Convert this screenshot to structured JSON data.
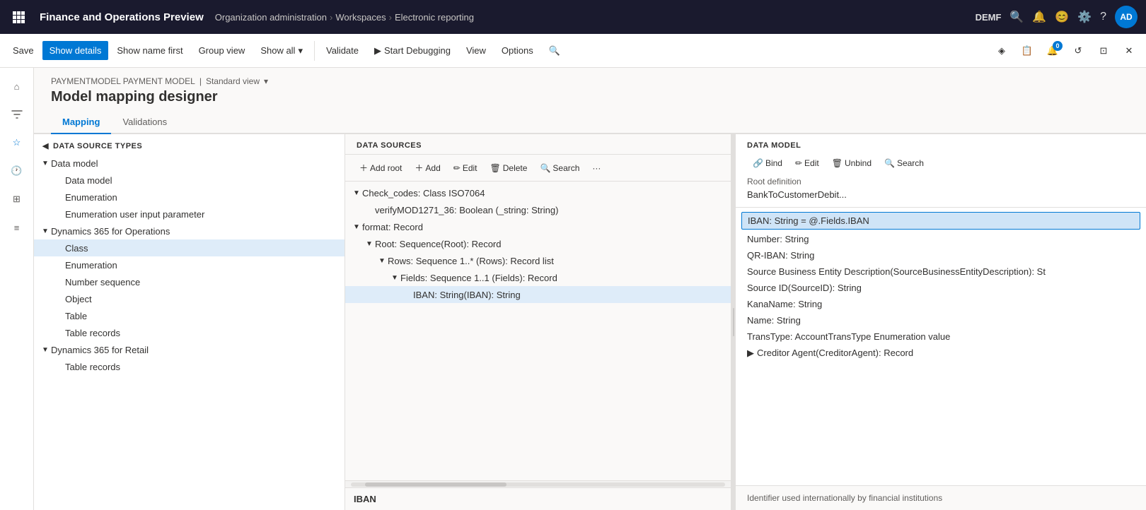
{
  "topNav": {
    "waffle": "⊞",
    "title": "Finance and Operations Preview",
    "breadcrumb": [
      "Organization administration",
      "Workspaces",
      "Electronic reporting"
    ],
    "envLabel": "DEMF",
    "avatar": "AD"
  },
  "toolbar": {
    "save": "Save",
    "showDetails": "Show details",
    "showNameFirst": "Show name first",
    "groupView": "Group view",
    "showAll": "Show all",
    "validate": "Validate",
    "startDebugging": "Start Debugging",
    "view": "View",
    "options": "Options"
  },
  "breadcrumb": {
    "model": "PAYMENTMODEL PAYMENT MODEL",
    "view": "Standard view"
  },
  "pageTitle": "Model mapping designer",
  "tabs": [
    "Mapping",
    "Validations"
  ],
  "activeTab": "Mapping",
  "leftPanel": {
    "header": "DATA SOURCE TYPES",
    "items": [
      {
        "label": "Data model",
        "indent": 0,
        "expandable": true,
        "expanded": true
      },
      {
        "label": "Data model",
        "indent": 1,
        "expandable": false
      },
      {
        "label": "Enumeration",
        "indent": 1,
        "expandable": false
      },
      {
        "label": "Enumeration user input parameter",
        "indent": 1,
        "expandable": false
      },
      {
        "label": "Dynamics 365 for Operations",
        "indent": 0,
        "expandable": true,
        "expanded": true
      },
      {
        "label": "Class",
        "indent": 1,
        "expandable": false,
        "selected": true
      },
      {
        "label": "Enumeration",
        "indent": 1,
        "expandable": false
      },
      {
        "label": "Number sequence",
        "indent": 1,
        "expandable": false
      },
      {
        "label": "Object",
        "indent": 1,
        "expandable": false
      },
      {
        "label": "Table",
        "indent": 1,
        "expandable": false
      },
      {
        "label": "Table records",
        "indent": 1,
        "expandable": false
      },
      {
        "label": "Dynamics 365 for Retail",
        "indent": 0,
        "expandable": true,
        "expanded": true
      },
      {
        "label": "Table records",
        "indent": 1,
        "expandable": false
      }
    ]
  },
  "middlePanel": {
    "header": "DATA SOURCES",
    "buttons": [
      "Add root",
      "Add",
      "Edit",
      "Delete",
      "Search"
    ],
    "tree": [
      {
        "label": "Check_codes: Class ISO7064",
        "indent": 0,
        "expandable": true,
        "expanded": true
      },
      {
        "label": "verifyMOD1271_36: Boolean (_string: String)",
        "indent": 1,
        "expandable": false
      },
      {
        "label": "format: Record",
        "indent": 0,
        "expandable": true,
        "expanded": true
      },
      {
        "label": "Root: Sequence(Root): Record",
        "indent": 1,
        "expandable": true,
        "expanded": true
      },
      {
        "label": "Rows: Sequence 1..* (Rows): Record list",
        "indent": 2,
        "expandable": true,
        "expanded": true
      },
      {
        "label": "Fields: Sequence 1..1 (Fields): Record",
        "indent": 3,
        "expandable": true,
        "expanded": true
      },
      {
        "label": "IBAN: String(IBAN): String",
        "indent": 4,
        "expandable": false,
        "selected": true
      }
    ],
    "footer": "IBAN"
  },
  "rightPanel": {
    "header": "DATA MODEL",
    "buttons": [
      "Bind",
      "Edit",
      "Unbind",
      "Search"
    ],
    "rootDef": "Root definition",
    "rootDefValue": "BankToCustomerDebit...",
    "selectedItem": "IBAN: String = @.Fields.IBAN",
    "items": [
      {
        "label": "Number: String",
        "indent": 0
      },
      {
        "label": "QR-IBAN: String",
        "indent": 0
      },
      {
        "label": "Source Business Entity Description(SourceBusinessEntityDescription): St",
        "indent": 0
      },
      {
        "label": "Source ID(SourceID): String",
        "indent": 0
      },
      {
        "label": "KanaName: String",
        "indent": 0
      },
      {
        "label": "Name: String",
        "indent": 0
      },
      {
        "label": "TransType: AccountTransType Enumeration value",
        "indent": 0
      },
      {
        "label": "Creditor Agent(CreditorAgent): Record",
        "indent": 0,
        "expandable": true
      }
    ],
    "footer": "Identifier used internationally by financial institutions"
  }
}
